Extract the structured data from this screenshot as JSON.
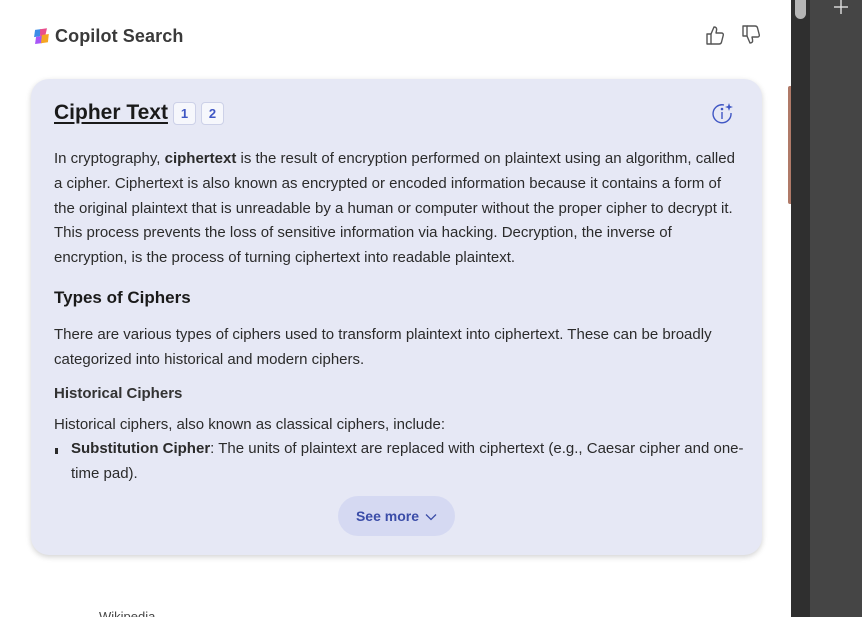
{
  "header": {
    "brand": "Copilot Search",
    "logo_icon": "copilot-logo-icon",
    "thumbs_up_icon": "thumbs-up-icon",
    "thumbs_down_icon": "thumbs-down-icon"
  },
  "card": {
    "title": "Cipher Text",
    "citations": [
      "1",
      "2"
    ],
    "info_icon": "info-sparkle-icon",
    "intro": {
      "before": "In cryptography, ",
      "bold": "ciphertext",
      "after": " is the result of encryption performed on plaintext using an algorithm, called a cipher. Ciphertext is also known as encrypted or encoded information because it contains a form of the original plaintext that is unreadable by a human or computer without the proper cipher to decrypt it. This process prevents the loss of sensitive information via hacking. Decryption, the inverse of encryption, is the process of turning ciphertext into readable plaintext."
    },
    "types_heading": "Types of Ciphers",
    "types_text": "There are various types of ciphers used to transform plaintext into ciphertext. These can be broadly categorized into historical and modern ciphers.",
    "historical_heading": "Historical Ciphers",
    "historical_intro": "Historical ciphers, also known as classical ciphers, include:",
    "bullets": [
      {
        "term": "Substitution Cipher",
        "text": ": The units of plaintext are replaced with ciphertext (e.g., Caesar cipher and one-time pad)."
      }
    ],
    "see_more": "See more",
    "see_more_icon": "chevron-down-icon"
  },
  "footer": {
    "source_partial": "Wikipedia"
  },
  "browser": {
    "new_tab_icon": "plus-icon"
  },
  "colors": {
    "card_bg": "#e6e8f5",
    "accent": "#3f56c4",
    "see_more_bg": "#d5d9f2"
  }
}
